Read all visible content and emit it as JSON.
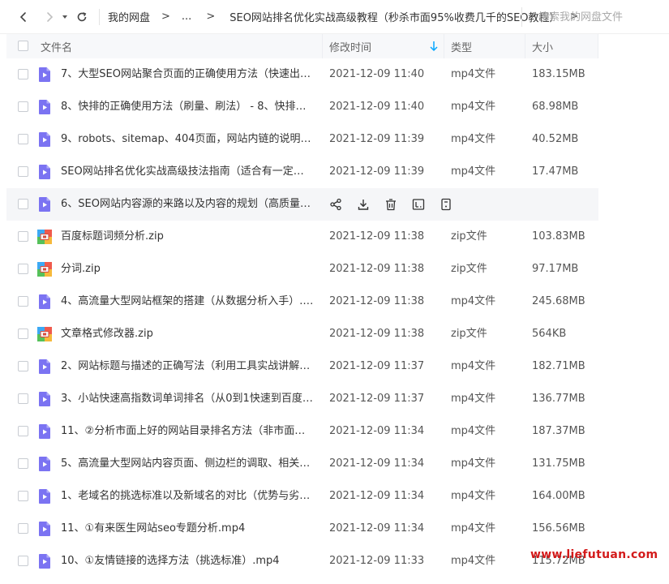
{
  "nav": {
    "crumbs": [
      "我的网盘",
      "...",
      "SEO网站排名优化实战高级教程（秒杀市面95%收费几千的SEO教程）"
    ],
    "arrow": ">"
  },
  "search": {
    "placeholder": "搜索我的网盘文件"
  },
  "columns": {
    "name": "文件名",
    "time": "修改时间",
    "type": "类型",
    "size": "大小"
  },
  "files": [
    {
      "name": "7、大型SEO网站聚合页面的正确使用方法（快速出词库...",
      "time": "2021-12-09 11:40",
      "type": "mp4文件",
      "size": "183.15MB",
      "icon": "video-file-icon"
    },
    {
      "name": "8、快排的正确使用方法（刷量、刷法） - 8、快排的正确...",
      "time": "2021-12-09 11:40",
      "type": "mp4文件",
      "size": "68.98MB",
      "icon": "video-file-icon"
    },
    {
      "name": "9、robots、sitemap、404页面，网站内链的说明（正...",
      "time": "2021-12-09 11:39",
      "type": "mp4文件",
      "size": "40.52MB",
      "icon": "video-file-icon"
    },
    {
      "name": "SEO网站排名优化实战高级技法指南（适合有一定基础的...",
      "time": "2021-12-09 11:39",
      "type": "mp4文件",
      "size": "17.47MB",
      "icon": "video-file-icon"
    },
    {
      "name": "6、SEO网站内容源的来路以及内容的规划（高质量内容...",
      "time": "",
      "type": "",
      "size": "",
      "icon": "video-file-icon",
      "hover": true
    },
    {
      "name": "百度标题词频分析.zip",
      "time": "2021-12-09 11:38",
      "type": "zip文件",
      "size": "103.83MB",
      "icon": "zip-file-icon"
    },
    {
      "name": "分词.zip",
      "time": "2021-12-09 11:38",
      "type": "zip文件",
      "size": "97.17MB",
      "icon": "zip-file-icon"
    },
    {
      "name": "4、高流量大型网站框架的搭建（从数据分析入手）.mp4",
      "time": "2021-12-09 11:38",
      "type": "mp4文件",
      "size": "245.68MB",
      "icon": "video-file-icon"
    },
    {
      "name": "文章格式修改器.zip",
      "time": "2021-12-09 11:38",
      "type": "zip文件",
      "size": "564KB",
      "icon": "zip-file-icon"
    },
    {
      "name": "2、网站标题与描述的正确写法（利用工具实战讲解）.mp4",
      "time": "2021-12-09 11:37",
      "type": "mp4文件",
      "size": "182.71MB",
      "icon": "video-file-icon"
    },
    {
      "name": "3、小站快速高指数词单词排名（从0到1快速到百度或任...",
      "time": "2021-12-09 11:37",
      "type": "mp4文件",
      "size": "136.77MB",
      "icon": "video-file-icon"
    },
    {
      "name": "11、②分析市面上好的网站目录排名方法（非市面上垃圾...",
      "time": "2021-12-09 11:34",
      "type": "mp4文件",
      "size": "187.37MB",
      "icon": "video-file-icon"
    },
    {
      "name": "5、高流量大型网站内容页面、侧边栏的调取、相关推...",
      "time": "2021-12-09 11:34",
      "type": "mp4文件",
      "size": "131.75MB",
      "icon": "video-file-icon"
    },
    {
      "name": "1、老域名的挑选标准以及新域名的对比（优势与劣势）....",
      "time": "2021-12-09 11:34",
      "type": "mp4文件",
      "size": "164.00MB",
      "icon": "video-file-icon"
    },
    {
      "name": "11、①有来医生网站seo专题分析.mp4",
      "time": "2021-12-09 11:34",
      "type": "mp4文件",
      "size": "156.56MB",
      "icon": "video-file-icon"
    },
    {
      "name": "10、①友情链接的选择方法（挑选标准）.mp4",
      "time": "2021-12-09 11:33",
      "type": "mp4文件",
      "size": "115.72MB",
      "icon": "video-file-icon"
    }
  ],
  "hover_actions": [
    "share-icon",
    "download-icon",
    "delete-icon",
    "rename-icon",
    "more-icon"
  ],
  "watermark": "www.liefutuan.com",
  "colors": {
    "accent": "#06a7ff",
    "video_icon": "#7b73f2",
    "watermark": "#d31a1a"
  }
}
